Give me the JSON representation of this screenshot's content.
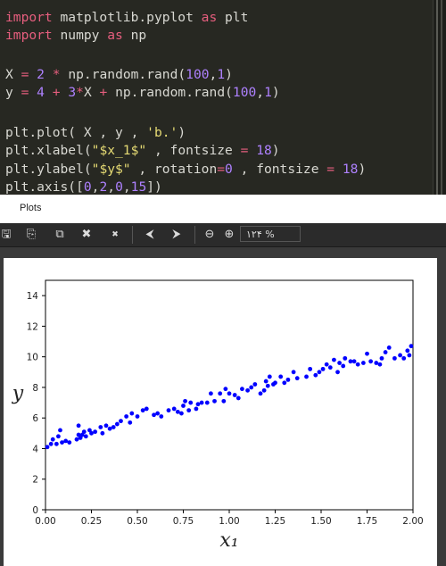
{
  "code": {
    "lines": [
      [
        {
          "t": "import",
          "c": "kw"
        },
        {
          "t": " matplotlib.pyplot ",
          "c": ""
        },
        {
          "t": "as",
          "c": "kw"
        },
        {
          "t": " plt",
          "c": ""
        }
      ],
      [
        {
          "t": "import",
          "c": "kw"
        },
        {
          "t": " numpy ",
          "c": ""
        },
        {
          "t": "as",
          "c": "kw"
        },
        {
          "t": " np",
          "c": ""
        }
      ],
      [],
      [
        {
          "t": "X ",
          "c": ""
        },
        {
          "t": "=",
          "c": "kw"
        },
        {
          "t": " ",
          "c": ""
        },
        {
          "t": "2",
          "c": "num"
        },
        {
          "t": " ",
          "c": ""
        },
        {
          "t": "*",
          "c": "kw"
        },
        {
          "t": " np.random.rand(",
          "c": ""
        },
        {
          "t": "100",
          "c": "num"
        },
        {
          "t": ",",
          "c": ""
        },
        {
          "t": "1",
          "c": "num"
        },
        {
          "t": ")",
          "c": ""
        }
      ],
      [
        {
          "t": "y ",
          "c": ""
        },
        {
          "t": "=",
          "c": "kw"
        },
        {
          "t": " ",
          "c": ""
        },
        {
          "t": "4",
          "c": "num"
        },
        {
          "t": " ",
          "c": ""
        },
        {
          "t": "+",
          "c": "kw"
        },
        {
          "t": " ",
          "c": ""
        },
        {
          "t": "3",
          "c": "num"
        },
        {
          "t": "*",
          "c": "kw"
        },
        {
          "t": "X ",
          "c": ""
        },
        {
          "t": "+",
          "c": "kw"
        },
        {
          "t": " np.random.rand(",
          "c": ""
        },
        {
          "t": "100",
          "c": "num"
        },
        {
          "t": ",",
          "c": ""
        },
        {
          "t": "1",
          "c": "num"
        },
        {
          "t": ")",
          "c": ""
        }
      ],
      [],
      [
        {
          "t": "plt.plot( X , y , ",
          "c": ""
        },
        {
          "t": "'b.'",
          "c": "str"
        },
        {
          "t": ")",
          "c": ""
        }
      ],
      [
        {
          "t": "plt.xlabel(",
          "c": ""
        },
        {
          "t": "\"$x_1$\"",
          "c": "str"
        },
        {
          "t": " , fontsize ",
          "c": ""
        },
        {
          "t": "=",
          "c": "kw"
        },
        {
          "t": " ",
          "c": ""
        },
        {
          "t": "18",
          "c": "num"
        },
        {
          "t": ")",
          "c": ""
        }
      ],
      [
        {
          "t": "plt.ylabel(",
          "c": ""
        },
        {
          "t": "\"$y$\"",
          "c": "str"
        },
        {
          "t": " , rotation",
          "c": ""
        },
        {
          "t": "=",
          "c": "kw"
        },
        {
          "t": "0",
          "c": "num"
        },
        {
          "t": " , fontsize ",
          "c": ""
        },
        {
          "t": "=",
          "c": "kw"
        },
        {
          "t": " ",
          "c": ""
        },
        {
          "t": "18",
          "c": "num"
        },
        {
          "t": ")",
          "c": ""
        }
      ],
      [
        {
          "t": "plt.axis([",
          "c": ""
        },
        {
          "t": "0",
          "c": "num"
        },
        {
          "t": ",",
          "c": ""
        },
        {
          "t": "2",
          "c": "num"
        },
        {
          "t": ",",
          "c": ""
        },
        {
          "t": "0",
          "c": "num"
        },
        {
          "t": ",",
          "c": ""
        },
        {
          "t": "15",
          "c": "num"
        },
        {
          "t": "])",
          "c": ""
        }
      ]
    ]
  },
  "plots_pane": {
    "title": "Plots",
    "toolbar": {
      "icons": [
        "save-icon",
        "save-all-icon",
        "copy-icon",
        "close-icon",
        "close-all-icon",
        "previous-icon",
        "next-icon",
        "zoom-out-icon",
        "zoom-in-icon"
      ],
      "glyphs": [
        "🖫",
        "⎘",
        "⧉",
        "✖",
        "✖",
        "⮜",
        "⮞",
        "⊖",
        "⊕"
      ],
      "zoom_level": "۱۲۴ %"
    }
  },
  "chart_data": {
    "type": "scatter",
    "xlabel": "x₁",
    "ylabel": "y",
    "xlim": [
      0,
      2
    ],
    "ylim": [
      0,
      15
    ],
    "xticks": [
      "0.00",
      "0.25",
      "0.50",
      "0.75",
      "1.00",
      "1.25",
      "1.50",
      "1.75",
      "2.00"
    ],
    "yticks": [
      "0",
      "2",
      "4",
      "6",
      "8",
      "10",
      "12",
      "14"
    ],
    "marker_color": "#0000ff",
    "points": [
      [
        0.01,
        4.1
      ],
      [
        0.03,
        4.3
      ],
      [
        0.04,
        4.6
      ],
      [
        0.06,
        4.3
      ],
      [
        0.07,
        4.8
      ],
      [
        0.08,
        5.2
      ],
      [
        0.09,
        4.4
      ],
      [
        0.13,
        4.4
      ],
      [
        0.17,
        4.6
      ],
      [
        0.18,
        4.9
      ],
      [
        0.18,
        5.5
      ],
      [
        0.19,
        4.7
      ],
      [
        0.2,
        4.9
      ],
      [
        0.21,
        5.1
      ],
      [
        0.22,
        4.8
      ],
      [
        0.25,
        5.0
      ],
      [
        0.27,
        5.1
      ],
      [
        0.3,
        5.4
      ],
      [
        0.31,
        5.0
      ],
      [
        0.33,
        5.5
      ],
      [
        0.35,
        5.3
      ],
      [
        0.39,
        5.6
      ],
      [
        0.41,
        5.8
      ],
      [
        0.46,
        5.7
      ],
      [
        0.47,
        6.3
      ],
      [
        0.5,
        6.1
      ],
      [
        0.53,
        6.5
      ],
      [
        0.55,
        6.6
      ],
      [
        0.59,
        6.2
      ],
      [
        0.63,
        6.1
      ],
      [
        0.67,
        6.5
      ],
      [
        0.7,
        6.6
      ],
      [
        0.72,
        6.4
      ],
      [
        0.74,
        6.3
      ],
      [
        0.75,
        6.8
      ],
      [
        0.76,
        7.1
      ],
      [
        0.78,
        6.5
      ],
      [
        0.79,
        7.0
      ],
      [
        0.82,
        6.6
      ],
      [
        0.85,
        7.0
      ],
      [
        0.88,
        7.0
      ],
      [
        0.9,
        7.6
      ],
      [
        0.92,
        7.1
      ],
      [
        0.95,
        7.6
      ],
      [
        0.97,
        7.1
      ],
      [
        0.98,
        7.9
      ],
      [
        1.0,
        7.6
      ],
      [
        1.03,
        7.5
      ],
      [
        1.05,
        7.3
      ],
      [
        1.07,
        7.9
      ],
      [
        1.12,
        8.0
      ],
      [
        1.14,
        8.2
      ],
      [
        1.17,
        7.6
      ],
      [
        1.19,
        7.8
      ],
      [
        1.2,
        8.4
      ],
      [
        1.21,
        8.1
      ],
      [
        1.22,
        8.7
      ],
      [
        1.25,
        8.3
      ],
      [
        1.28,
        8.7
      ],
      [
        1.3,
        8.3
      ],
      [
        1.35,
        9.0
      ],
      [
        1.37,
        8.6
      ],
      [
        1.42,
        8.7
      ],
      [
        1.44,
        9.2
      ],
      [
        1.47,
        8.8
      ],
      [
        1.51,
        9.2
      ],
      [
        1.53,
        9.5
      ],
      [
        1.55,
        9.3
      ],
      [
        1.57,
        9.8
      ],
      [
        1.59,
        9.0
      ],
      [
        1.6,
        9.6
      ],
      [
        1.62,
        9.4
      ],
      [
        1.63,
        9.9
      ],
      [
        1.66,
        9.7
      ],
      [
        1.7,
        9.5
      ],
      [
        1.73,
        9.6
      ],
      [
        1.75,
        10.2
      ],
      [
        1.77,
        9.7
      ],
      [
        1.8,
        9.6
      ],
      [
        1.82,
        9.5
      ],
      [
        1.85,
        10.3
      ],
      [
        1.87,
        10.6
      ],
      [
        1.9,
        9.9
      ],
      [
        1.93,
        10.1
      ],
      [
        1.95,
        9.9
      ],
      [
        1.97,
        10.4
      ],
      [
        1.98,
        10.1
      ],
      [
        1.99,
        10.7
      ],
      [
        0.11,
        4.5
      ],
      [
        0.24,
        5.2
      ],
      [
        0.44,
        6.1
      ],
      [
        0.61,
        6.3
      ],
      [
        0.83,
        6.9
      ],
      [
        1.1,
        7.8
      ],
      [
        1.32,
        8.5
      ],
      [
        1.49,
        9.0
      ],
      [
        1.68,
        9.7
      ],
      [
        1.83,
        9.9
      ],
      [
        0.37,
        5.4
      ],
      [
        1.24,
        8.2
      ]
    ]
  }
}
